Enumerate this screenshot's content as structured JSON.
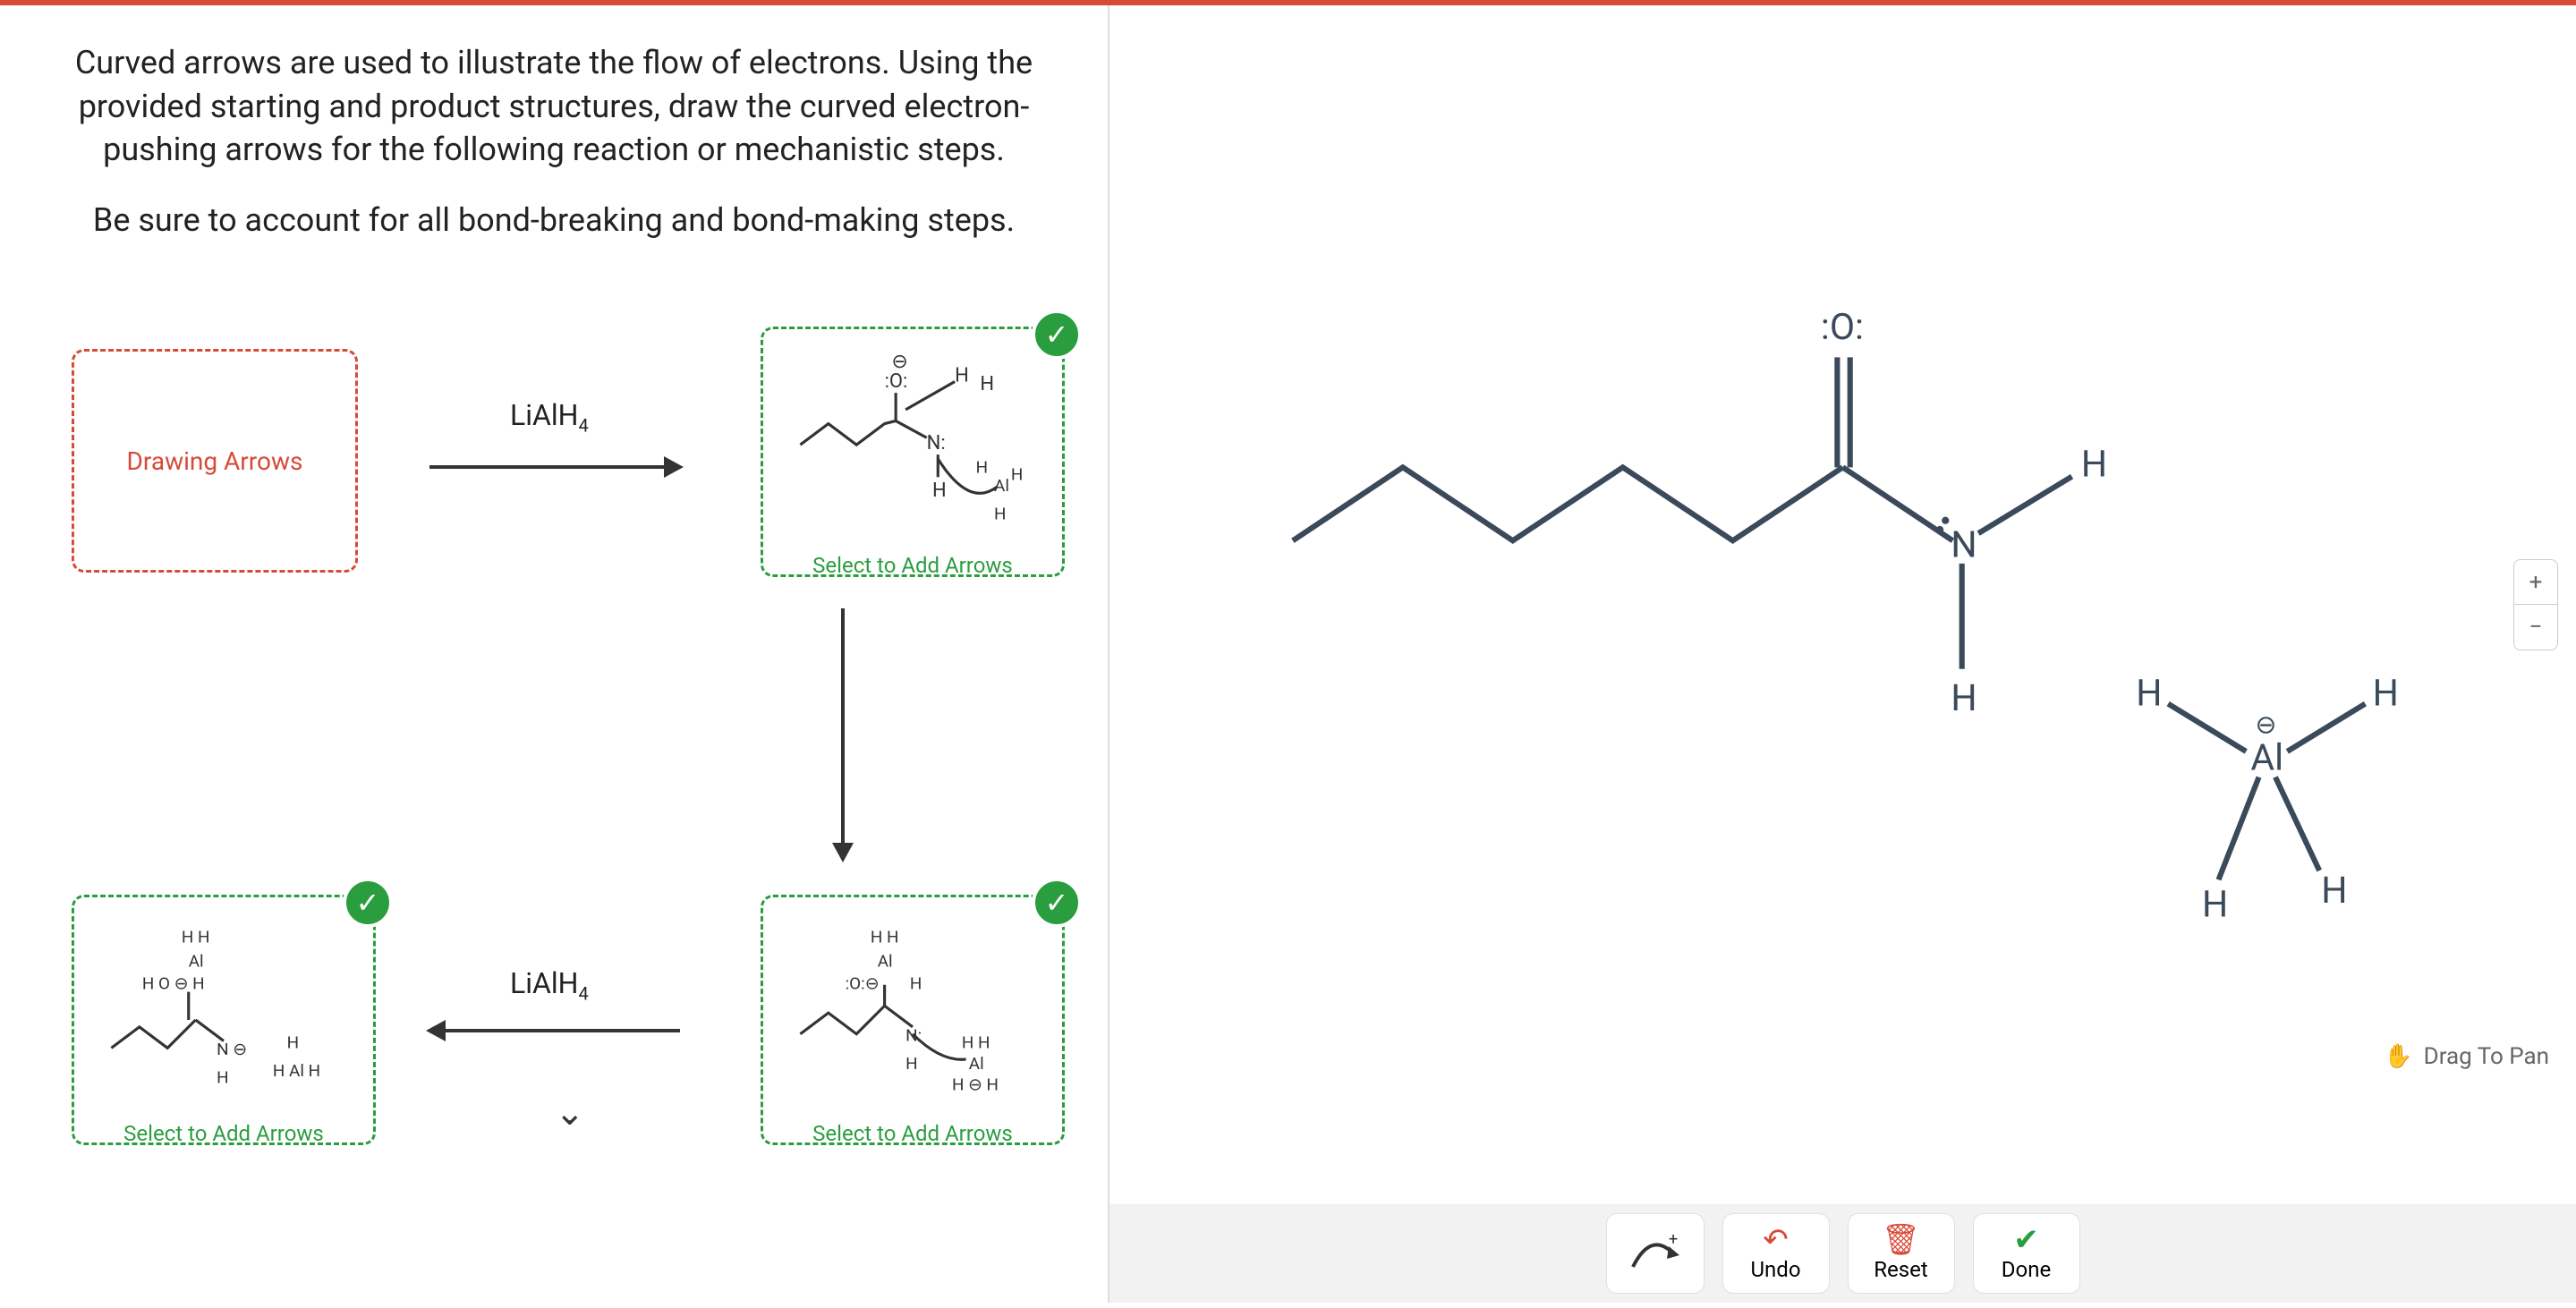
{
  "question": {
    "para1": "Curved arrows are used to illustrate the flow of electrons. Using the provided starting and product structures, draw the curved electron-pushing arrows for the following reaction or mechanistic steps.",
    "para2": "Be sure to account for all bond-breaking and bond-making steps."
  },
  "steps": {
    "drawing_label": "Drawing Arrows",
    "select_label": "Select to Add Arrows",
    "reagent1": "LiAlH",
    "reagent1_sub": "4",
    "reagent2": "LiAlH",
    "reagent2_sub": "4"
  },
  "canvas": {
    "oxygen_label": ":O:",
    "nitrogen_label": "N",
    "h_labels": [
      "H",
      "H",
      "H",
      "H",
      "H",
      "H"
    ],
    "al_label": "Al",
    "al_charge": "⊖"
  },
  "toolbar": {
    "undo": "Undo",
    "reset": "Reset",
    "done": "Done"
  },
  "drag_label": "Drag To Pan",
  "zoom": {
    "plus": "+",
    "minus": "−"
  },
  "colors": {
    "accent_red": "#d84a38",
    "accent_green": "#2a9d3f"
  }
}
